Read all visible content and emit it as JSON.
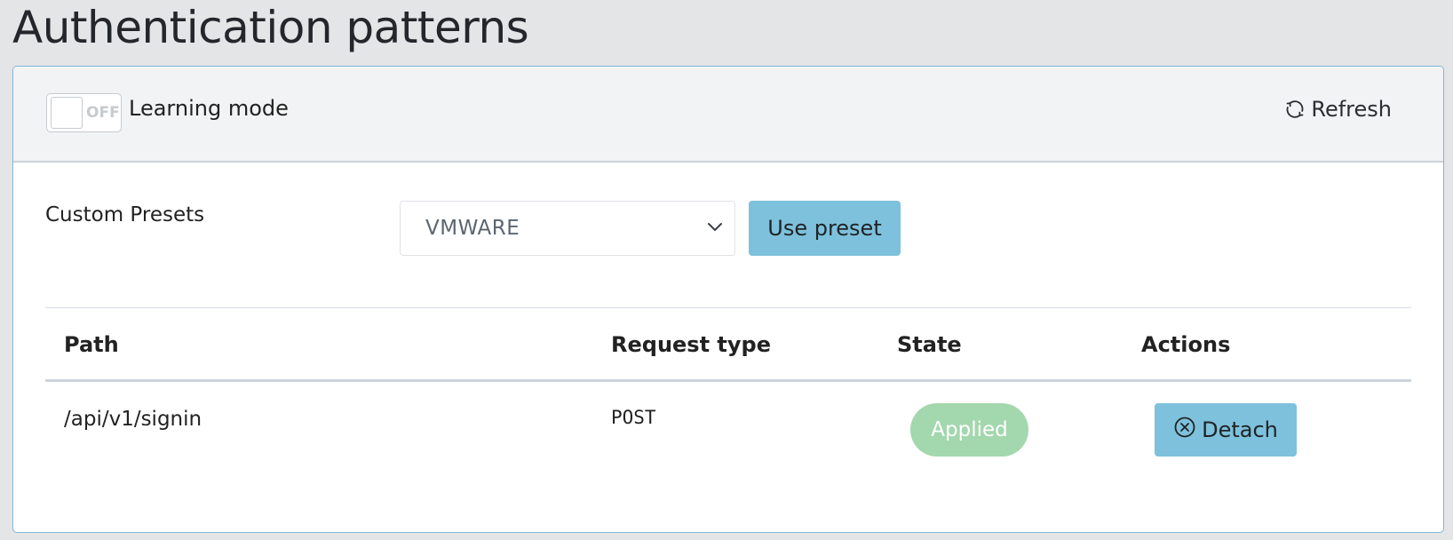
{
  "page": {
    "title": "Authentication patterns"
  },
  "header": {
    "toggle_state": "OFF",
    "learning_mode_label": "Learning mode",
    "refresh_label": "Refresh"
  },
  "presets": {
    "label": "Custom Presets",
    "selected": "VMWARE",
    "use_button_label": "Use preset"
  },
  "table": {
    "columns": [
      "Path",
      "Request type",
      "State",
      "Actions"
    ],
    "rows": [
      {
        "path": "/api/v1/signin",
        "request_type": "POST",
        "state": "Applied",
        "action": "Detach"
      }
    ]
  },
  "colors": {
    "accent": "#7ec1dc",
    "applied_badge": "#a3d7ad",
    "card_border": "#7fb6d8"
  },
  "icons": {
    "refresh": "refresh-icon",
    "detach": "close-circle-icon",
    "select": "chevron-down-icon"
  }
}
